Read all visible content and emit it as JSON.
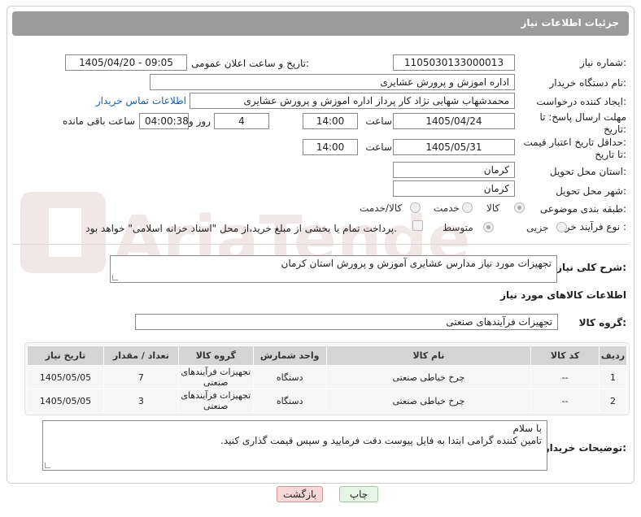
{
  "header": {
    "title": "جزئیات اطلاعات نیاز"
  },
  "form": {
    "need_number_label": "شماره نیاز:",
    "need_number": "1105030133000013",
    "announce_label": "تاریخ و ساعت اعلان عمومی:",
    "announce_value": "1405/04/20 - 09:05",
    "buyer_org_label": "نام دستگاه خریدار:",
    "buyer_org": "اداره اموزش و پرورش عشایری",
    "creator_label": "ایجاد کننده درخواست:",
    "creator": "محمدشهاب شهابی نژاد کار پرداز اداره اموزش و پرورش عشایری",
    "contact_link": "اطلاعات تماس خریدار",
    "deadline_label_1": "مهلت ارسال پاسخ: تا",
    "deadline_label_2": "تاریخ:",
    "deadline_date": "1405/04/24",
    "time_label": "ساعت",
    "deadline_time": "14:00",
    "days_value": "4",
    "days_label": "روز و",
    "remaining_time": "04:00:38",
    "remaining_label": "ساعت باقی مانده",
    "validity_label_1": "حداقل تاریخ اعتبار قیمت:",
    "validity_label_2": "تا تاریخ:",
    "validity_date": "1405/05/31",
    "validity_time": "14:00",
    "province_label": "استان محل تحویل:",
    "province": "کرمان",
    "city_label": "شهر محل تحویل:",
    "city": "کرمان",
    "category_label": "طبقه بندی موضوعی:",
    "category_options": [
      "کالا",
      "خدمت",
      "کالا/خدمت"
    ],
    "category_selected": "کالا",
    "process_label": "نوع فرآیند خرید :",
    "process_options": [
      "جزیی",
      "متوسط"
    ],
    "process_selected": "متوسط",
    "payment_note": "پرداخت تمام یا بخشی از مبلغ خرید،از محل \"اسناد خزانه اسلامی\" خواهد بود."
  },
  "description": {
    "label": "شرح کلی نیاز:",
    "value": "تجهیزات مورد نیاز مدارس عشایری آموزش و پرورش استان کرمان"
  },
  "goods": {
    "section_title": "اطلاعات کالاهای مورد نیاز",
    "group_label": "گروه کالا:",
    "group_value": "تجهیزات فرآیندهای صنعتی",
    "columns": [
      "ردیف",
      "کد کالا",
      "نام کالا",
      "واحد شمارش",
      "گروه کالا",
      "تعداد / مقدار",
      "تاریخ نیاز"
    ],
    "rows": [
      [
        "1",
        "--",
        "چرخ خیاطی صنعتی",
        "دستگاه",
        "تجهیزات فرآیندهای صنعتی",
        "7",
        "1405/05/05"
      ],
      [
        "2",
        "--",
        "چرخ خیاطی صنعتی",
        "دستگاه",
        "تجهیزات فرآیندهای صنعتی",
        "3",
        "1405/05/05"
      ]
    ]
  },
  "buyer_notes": {
    "label": "توضیحات خریدار:",
    "line1": "با سلام",
    "line2": "تامین کننده گرامی ابتدا به فایل پیوست دقت فرمایید و سپس قیمت گذاری کنید."
  },
  "buttons": {
    "print": "چاپ",
    "back": "بازگشت"
  },
  "watermark": "AriaTender.neT",
  "colors": {
    "header_bg": "#9b9b9b",
    "link": "#1a5fb4",
    "back_btn_bg": "#f8d7d7",
    "print_btn_bg": "#e4f5e4"
  }
}
